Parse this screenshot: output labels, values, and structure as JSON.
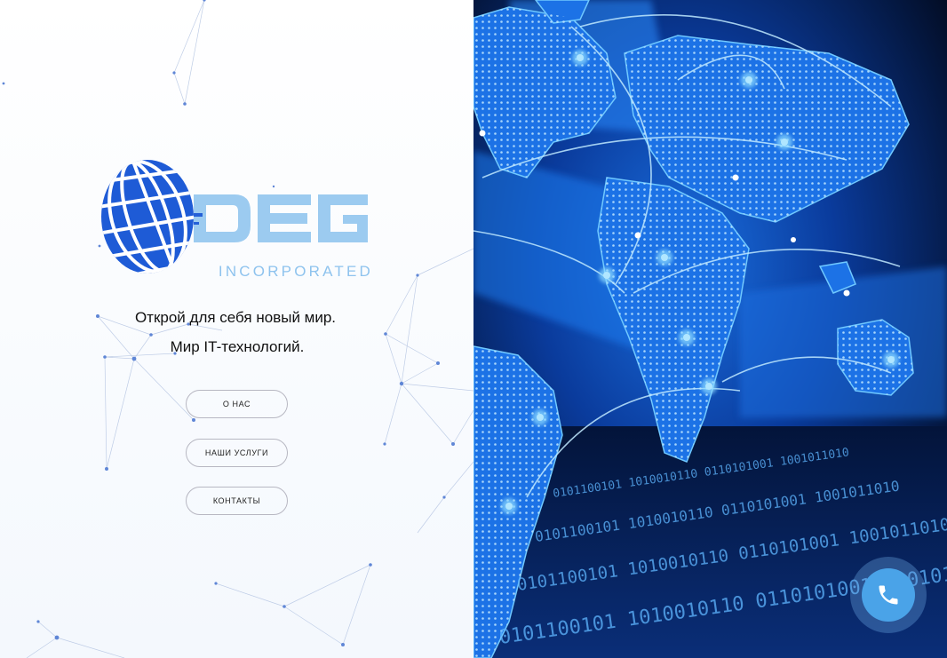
{
  "brand": {
    "logo_text": "DEG",
    "logo_subtext": "INCORPORATED",
    "colors": {
      "primary_blue": "#1e5bd6",
      "light_blue": "#9ccbf0"
    }
  },
  "hero": {
    "tagline_line1": "Открой для себя новый мир.",
    "tagline_line2": "Мир IT-технологий."
  },
  "nav": {
    "about_label": "О НАС",
    "services_label": "НАШИ УСЛУГИ",
    "contacts_label": "КОНТАКТЫ"
  },
  "background_image": {
    "binary_text": "0101100101 1010010110 0110101001 1001011010"
  },
  "widgets": {
    "call_icon": "phone-icon"
  }
}
